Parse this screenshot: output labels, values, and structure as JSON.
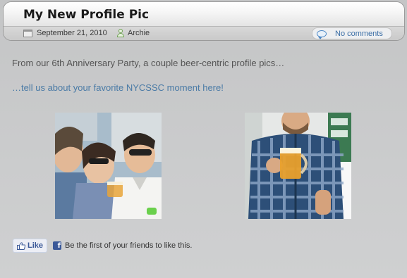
{
  "post": {
    "title": "My New Profile Pic",
    "date": "September 21, 2010",
    "author": "Archie",
    "comments": "No comments",
    "intro": "From our 6th Anniversary Party, a couple beer-centric profile pics…",
    "moment_link": "…tell us about your favorite NYCSSC moment here!"
  },
  "photos": [
    {
      "subject": "group of friends laughing with beer"
    },
    {
      "subject": "man in plaid shirt holding beer mug"
    }
  ],
  "facebook": {
    "like_label": "Like",
    "like_text": "Be the first of your friends to like this."
  },
  "colors": {
    "link": "#4a7aa6",
    "facebook_blue": "#3b5998"
  }
}
